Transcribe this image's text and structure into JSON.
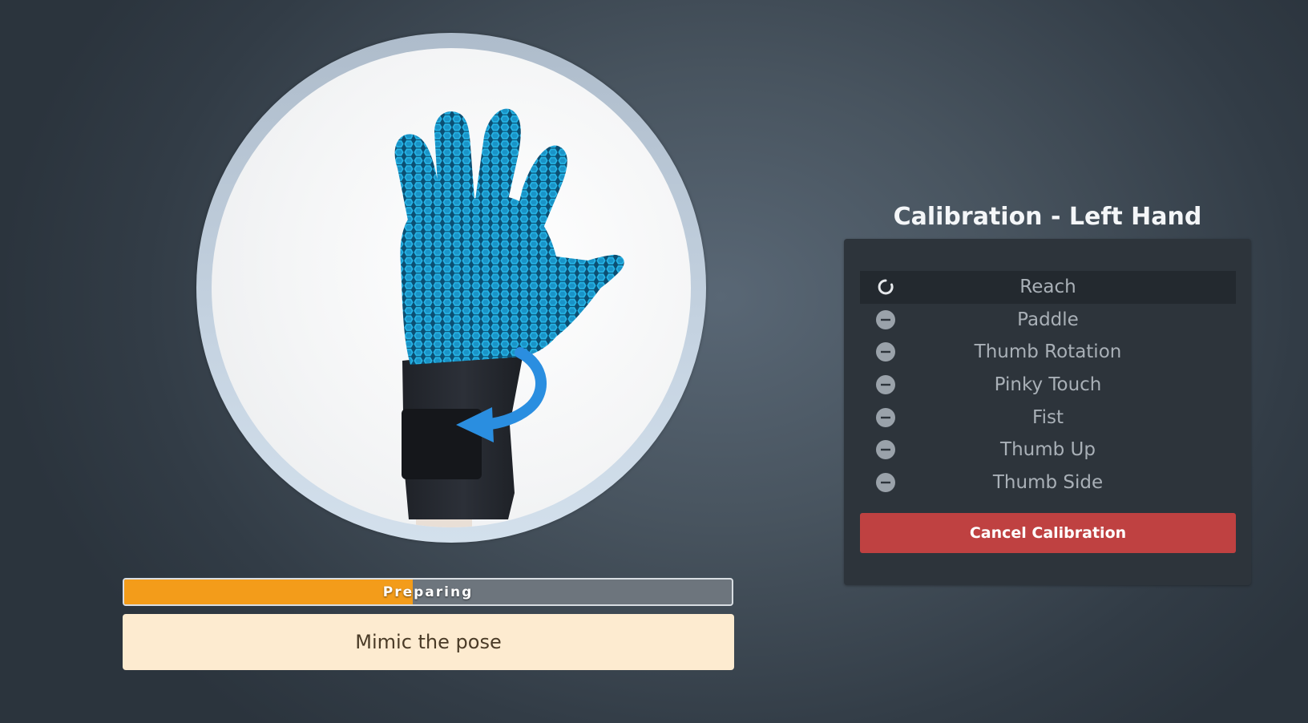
{
  "pose": {
    "image_description_icon": "gloved-left-hand-rotate-icon",
    "arrow_color": "#2a8ee0",
    "glove_color": "#1fa3d6"
  },
  "progress": {
    "label": "Preparing",
    "fraction": 0.475,
    "fill_color": "#f39c1a",
    "track_color": "#6d757d"
  },
  "instruction": {
    "text": "Mimic the pose"
  },
  "panel": {
    "title": "Calibration - Left Hand",
    "steps": [
      {
        "label": "Reach",
        "status": "in-progress",
        "icon": "spinner-icon"
      },
      {
        "label": "Paddle",
        "status": "pending",
        "icon": "minus-circle-icon"
      },
      {
        "label": "Thumb Rotation",
        "status": "pending",
        "icon": "minus-circle-icon"
      },
      {
        "label": "Pinky Touch",
        "status": "pending",
        "icon": "minus-circle-icon"
      },
      {
        "label": "Fist",
        "status": "pending",
        "icon": "minus-circle-icon"
      },
      {
        "label": "Thumb Up",
        "status": "pending",
        "icon": "minus-circle-icon"
      },
      {
        "label": "Thumb Side",
        "status": "pending",
        "icon": "minus-circle-icon"
      }
    ],
    "cancel_label": "Cancel Calibration",
    "cancel_color": "#bf4141"
  }
}
